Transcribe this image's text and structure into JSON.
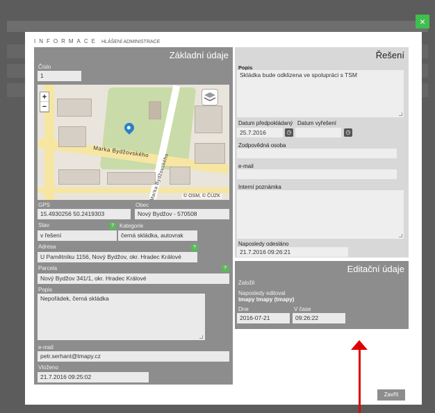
{
  "modal": {
    "title": "INFORMACE",
    "subtitle": "HLÁŠENÍ ADMINISTRACE",
    "close_icon": "×"
  },
  "basic": {
    "heading": "Základní údaje",
    "cislo_label": "Číslo",
    "cislo_value": "1",
    "map_attribution": "© OSM, © ČÚZK",
    "street_label": "Marka Bydžovského",
    "street_label_vertical": "Marka Bydžovského",
    "zoom_in": "+",
    "zoom_out": "−",
    "gps_label": "GPS",
    "gps_value": "15.4930256 50.2419303",
    "obec_label": "Obec",
    "obec_value": "Nový Bydžov - 570508",
    "stav_label": "Stav",
    "stav_value": "v řešení",
    "kategorie_label": "Kategorie",
    "kategorie_value": "černá skládka, autovrak",
    "adresa_label": "Adresa",
    "adresa_value": "U Pamětníku 1156, Nový Bydžov, okr. Hradec Králové",
    "parcela_label": "Parcela",
    "parcela_value": "Nový Bydžov 341/1, okr. Hradec Králové",
    "popis_label": "Popis",
    "popis_value": "Nepořádek, černá skládka",
    "email_label": "e-mail",
    "email_value": "petr.serhant@tmapy.cz",
    "vlozeno_label": "Vloženo",
    "vlozeno_value": "21.7.2016 09:25:02",
    "help": "?"
  },
  "reseni": {
    "heading": "Řešení",
    "popis_label": "Popis",
    "popis_value": "Skládka bude odklizena ve spolupráci s TSM",
    "datum_pred_label": "Datum předpokládaný",
    "datum_pred_value": "25.7.2016",
    "datum_vyr_label": "Datum vyřešení",
    "datum_vyr_value": "",
    "zodpovedna_label": "Zodpovědná osoba",
    "email_label": "e-mail",
    "poznamka_label": "Interní poznámka",
    "odeslano_label": "Naposledy odesláno",
    "odeslano_value": "21.7.2016 09:26:21"
  },
  "edit": {
    "heading": "Editační údaje",
    "zalozil_label": "Založil",
    "editoval_label": "Naposledy editoval",
    "editoval_value": "tmapy tmapy (tmapy)",
    "dne_label": "Dne",
    "dne_value": "2016-07-21",
    "cas_label": "V čase",
    "cas_value": "09:26:22"
  },
  "footer": {
    "close_label": "Zavřít"
  },
  "colors": {
    "accent_green": "#3fbf4f",
    "panel_gray": "#8d8d8d",
    "arrow_red": "#e00000"
  }
}
